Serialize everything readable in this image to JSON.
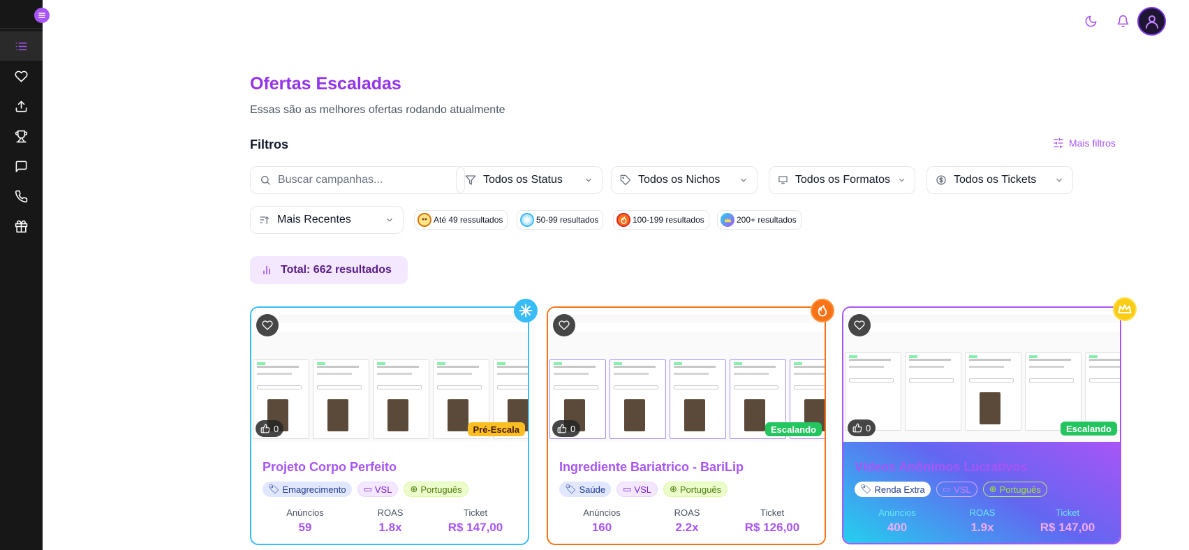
{
  "sidebar": {
    "items": [
      {
        "icon": "list-icon",
        "active": true
      },
      {
        "icon": "heart-icon"
      },
      {
        "icon": "upload-icon"
      },
      {
        "icon": "trophy-icon"
      },
      {
        "icon": "message-icon"
      },
      {
        "icon": "phone-icon"
      },
      {
        "icon": "gift-icon"
      }
    ]
  },
  "header": {
    "title": "Ofertas Escaladas",
    "subtitle": "Essas são as melhores ofertas rodando atualmente"
  },
  "filters": {
    "title": "Filtros",
    "more_filters_label": "Mais filtros",
    "search_placeholder": "Buscar campanhas...",
    "status_select": "Todos os Status",
    "niche_select": "Todos os Nichos",
    "format_select": "Todos os Formatos",
    "ticket_select": "Todos os Tickets",
    "sort_select": "Mais Recentes",
    "result_chips": [
      {
        "label": "Até 49 ressultados",
        "color": "#d97706"
      },
      {
        "label": "50-99 resultados",
        "color": "#38bdf8"
      },
      {
        "label": "100-199 resultados",
        "color": "#f97316"
      },
      {
        "label": "200+ resultados",
        "color": "#22d3ee"
      }
    ]
  },
  "total": {
    "label": "Total: 662 resultados"
  },
  "cards": [
    {
      "title": "Projeto Corpo Perfeito",
      "likes": "0",
      "status": "Pré-Escala",
      "niche": "Emagrecimento",
      "format": "VSL",
      "language": "Português",
      "ads_label": "Anúncios",
      "ads": "59",
      "roas_label": "ROAS",
      "roas": "1.8x",
      "ticket_label": "Ticket",
      "ticket": "R$ 147,00"
    },
    {
      "title": "Ingrediente Bariatrico - BariLip",
      "likes": "0",
      "status": "Escalando",
      "niche": "Saúde",
      "format": "VSL",
      "language": "Português",
      "ads_label": "Anúncios",
      "ads": "160",
      "roas_label": "ROAS",
      "roas": "2.2x",
      "ticket_label": "Ticket",
      "ticket": "R$ 126,00"
    },
    {
      "title": "Vídeos Anônimos Lucrativos",
      "likes": "0",
      "status": "Escalando",
      "niche": "Renda Extra",
      "format": "VSL",
      "language": "Português",
      "ads_label": "Anúncios",
      "ads": "400",
      "roas_label": "ROAS",
      "roas": "1.9x",
      "ticket_label": "Ticket",
      "ticket": "R$ 147,00"
    }
  ],
  "colors": {
    "accent": "#a855f7",
    "sidebar_bg": "#171717",
    "freeze": "#38bdf8",
    "fire": "#f97316",
    "crown": "#facc15",
    "pre_escala": "#fbbf24",
    "escalando": "#22c55e"
  }
}
